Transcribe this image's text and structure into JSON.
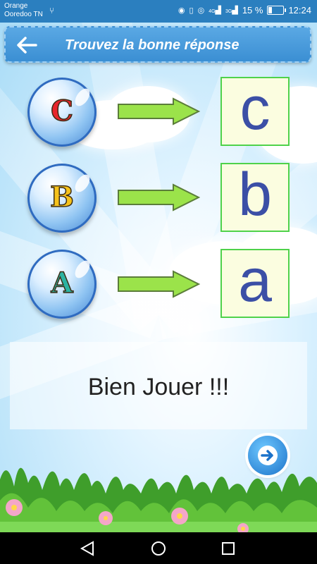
{
  "status_bar": {
    "carrier_line1": "Orange",
    "carrier_line2": "Ooredoo TN",
    "battery_pct": "15 %",
    "time": "12:24",
    "net_4g": "4G",
    "net_3g": "3G"
  },
  "header": {
    "title": "Trouvez la bonne réponse"
  },
  "matches": [
    {
      "letter": "C",
      "letter_color": "#e8262b",
      "answer": "c"
    },
    {
      "letter": "B",
      "letter_color": "#f6c21a",
      "answer": "b"
    },
    {
      "letter": "A",
      "letter_color": "#2bb3a2",
      "answer": "a"
    }
  ],
  "result": {
    "text": "Bien Jouer !!!"
  },
  "colors": {
    "header_bg": "#3b8fd3",
    "arrow_fill": "#9be34a",
    "answer_border": "#4fd24b",
    "answer_letter": "#3b4fa6"
  }
}
